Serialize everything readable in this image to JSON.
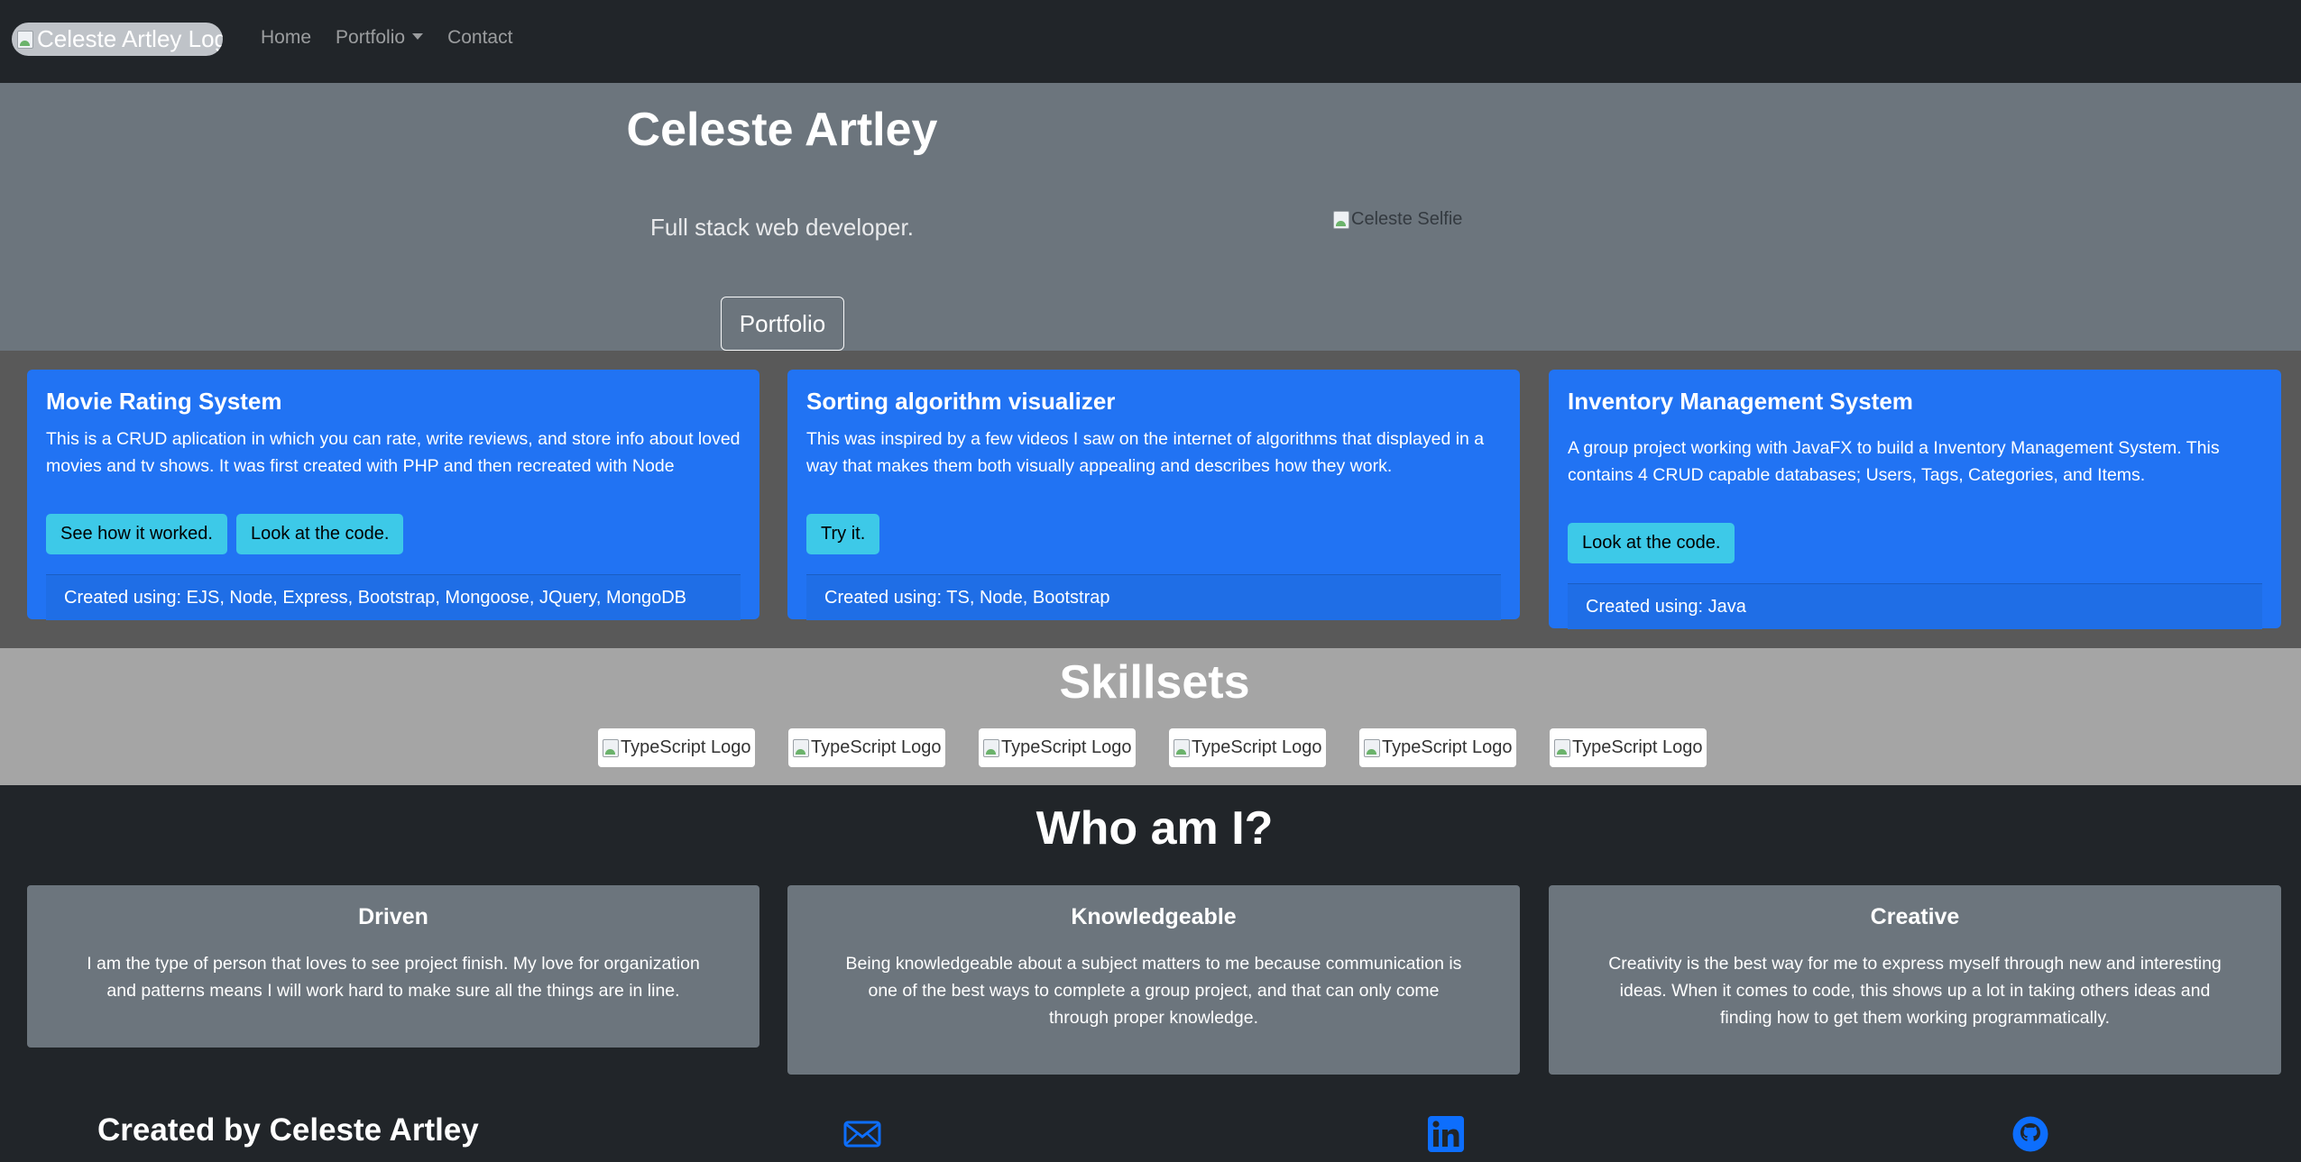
{
  "nav": {
    "logo_alt": "Celeste Artley Logo",
    "links": [
      {
        "label": "Home"
      },
      {
        "label": "Portfolio"
      },
      {
        "label": "Contact"
      }
    ]
  },
  "hero": {
    "title": "Celeste Artley",
    "subtitle": "Full stack web developer.",
    "button_label": "Portfolio",
    "selfie_alt": "Celeste Selfie"
  },
  "projects": [
    {
      "title": "Movie Rating System",
      "description": "This is a CRUD aplication in which you can rate, write reviews, and store info about loved movies and tv shows. It was first created with PHP and then recreated with Node",
      "buttons": [
        "See how it worked.",
        "Look at the code."
      ],
      "created_using": "Created using: EJS, Node, Express, Bootstrap, Mongoose, JQuery, MongoDB"
    },
    {
      "title": "Sorting algorithm visualizer",
      "description": "This was inspired by a few videos I saw on the internet of algorithms that displayed in a way that makes them both visually appealing and describes how they work.",
      "buttons": [
        "Try it."
      ],
      "created_using": "Created using: TS, Node, Bootstrap"
    },
    {
      "title": "Inventory Management System",
      "description": "A group project working with JavaFX to build a Inventory Management System. This contains 4 CRUD capable databases; Users, Tags, Categories, and Items.",
      "buttons": [
        "Look at the code."
      ],
      "created_using": "Created using: Java"
    }
  ],
  "skills": {
    "title": "Skillsets",
    "items": [
      "TypeScript Logo",
      "TypeScript Logo",
      "TypeScript Logo",
      "TypeScript Logo",
      "TypeScript Logo",
      "TypeScript Logo"
    ]
  },
  "who": {
    "title": "Who am I?",
    "cards": [
      {
        "title": "Driven",
        "text": "I am the type of person that loves to see project finish. My love for organization and patterns means I will work hard to make sure all the things are in line."
      },
      {
        "title": "Knowledgeable",
        "text": "Being knowledgeable about a subject matters to me because communication is one of the best ways to complete a group project, and that can only come through proper knowledge."
      },
      {
        "title": "Creative",
        "text": "Creativity is the best way for me to express myself through new and interesting ideas. When it comes to code, this shows up a lot in taking others ideas and finding how to get them working programmatically."
      }
    ]
  },
  "footer": {
    "title": "Created by Celeste Artley",
    "icons": [
      "envelope-icon",
      "linkedin-icon",
      "github-icon"
    ],
    "icon_color": "#0d6efd"
  }
}
